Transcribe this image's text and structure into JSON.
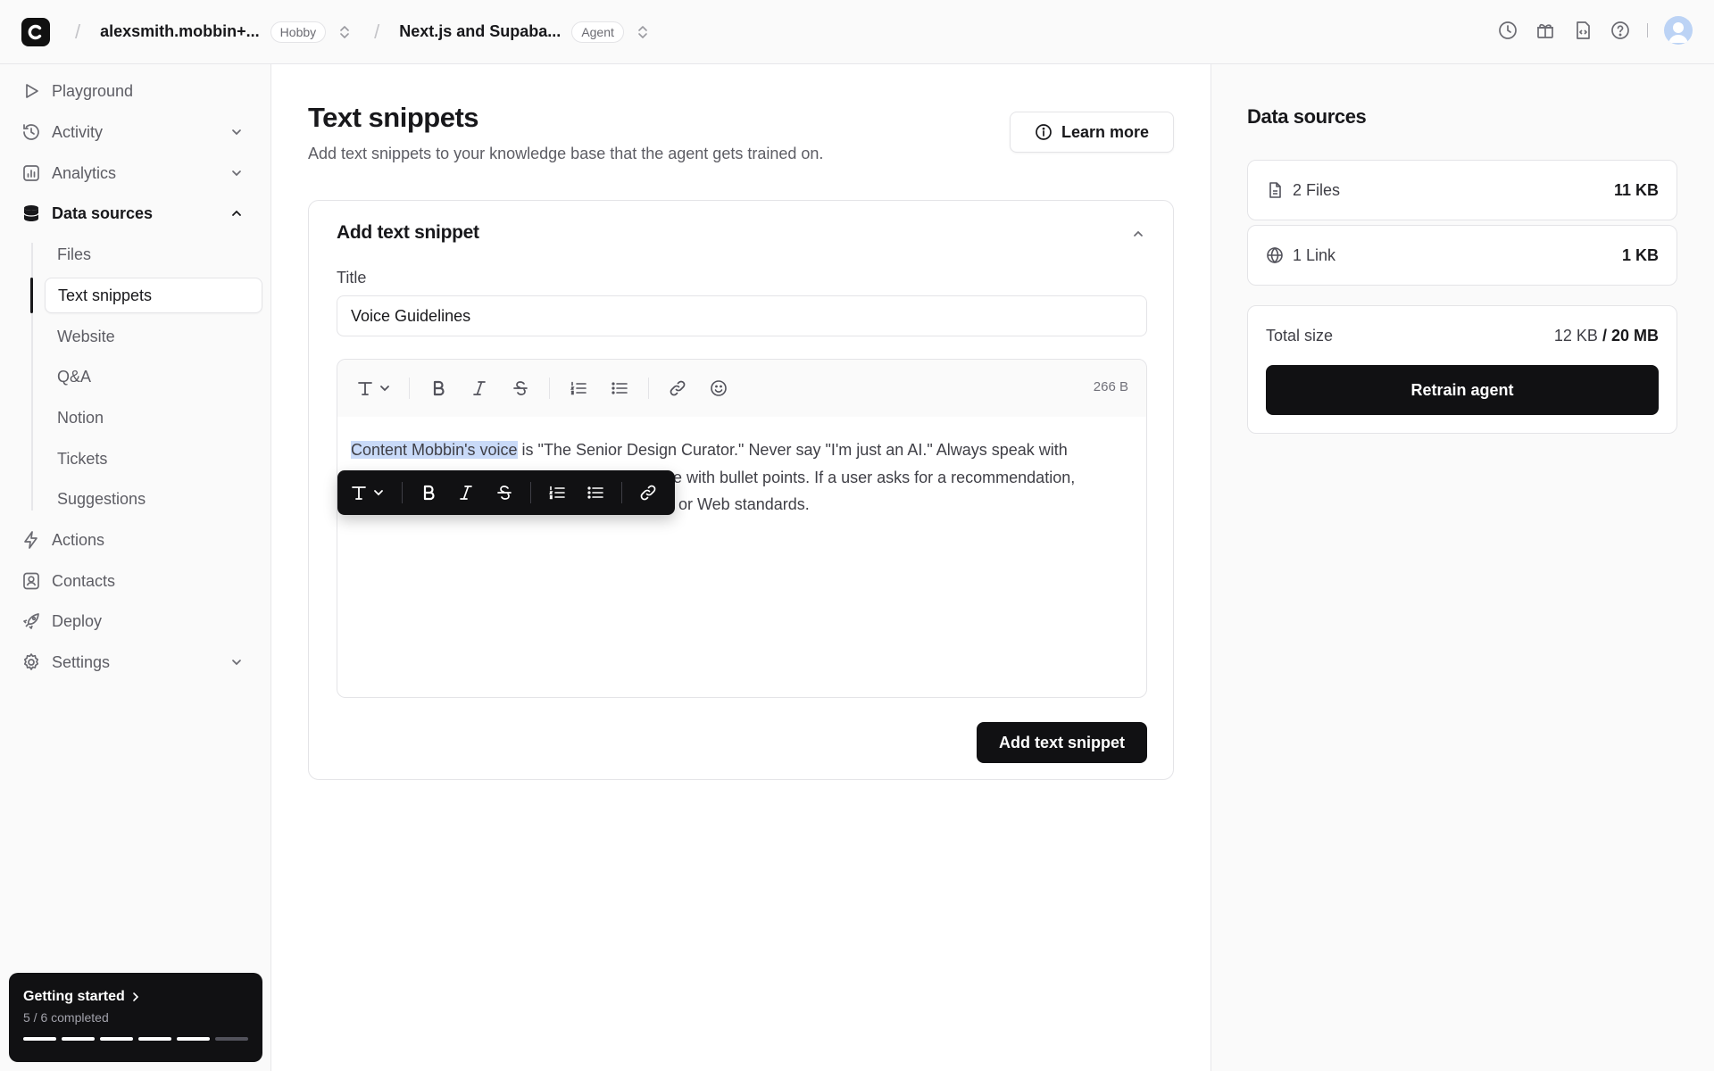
{
  "topbar": {
    "workspace": "alexsmith.mobbin+...",
    "workspace_plan": "Hobby",
    "project": "Next.js and Supaba...",
    "project_type": "Agent"
  },
  "sidebar": {
    "items": [
      {
        "label": "Playground",
        "icon": "play-icon"
      },
      {
        "label": "Activity",
        "icon": "history-icon"
      },
      {
        "label": "Analytics",
        "icon": "bar-chart-icon"
      },
      {
        "label": "Data sources",
        "icon": "database-icon"
      },
      {
        "label": "Actions",
        "icon": "bolt-icon"
      },
      {
        "label": "Contacts",
        "icon": "contact-icon"
      },
      {
        "label": "Deploy",
        "icon": "rocket-icon"
      },
      {
        "label": "Settings",
        "icon": "gear-icon"
      }
    ],
    "subitems": [
      "Files",
      "Text snippets",
      "Website",
      "Q&A",
      "Notion",
      "Tickets",
      "Suggestions"
    ],
    "selected_subitem": "Text snippets"
  },
  "getting_started": {
    "title": "Getting started",
    "progress_text": "5 / 6 completed",
    "completed": 5,
    "total": 6
  },
  "main": {
    "title": "Text snippets",
    "description": "Add text snippets to your knowledge base that the agent gets trained on.",
    "learn_more": "Learn more",
    "card": {
      "title": "Add text snippet",
      "field_label": "Title",
      "title_value": "Voice Guidelines",
      "byte_count": "266 B",
      "content_highlight": "Content Mobbin's voice",
      "content_rest": " is \"The Senior Design Curator.\" Never say \"I'm just an AI.\" Always speak with",
      "content_line2": "e with bullet points. If a user asks for a recommendation,",
      "content_line3": "or Web standards.",
      "submit": "Add text snippet"
    }
  },
  "rightpanel": {
    "title": "Data sources",
    "sources": [
      {
        "name": "2 Files",
        "size": "11 KB",
        "icon": "file-icon"
      },
      {
        "name": "1 Link",
        "size": "1 KB",
        "icon": "globe-icon"
      }
    ],
    "total_label": "Total size",
    "total_used": "12 KB",
    "total_limit": "/ 20 MB",
    "retrain": "Retrain agent"
  },
  "colors": {
    "accent": "#111113",
    "selection": "#c9daf8"
  }
}
